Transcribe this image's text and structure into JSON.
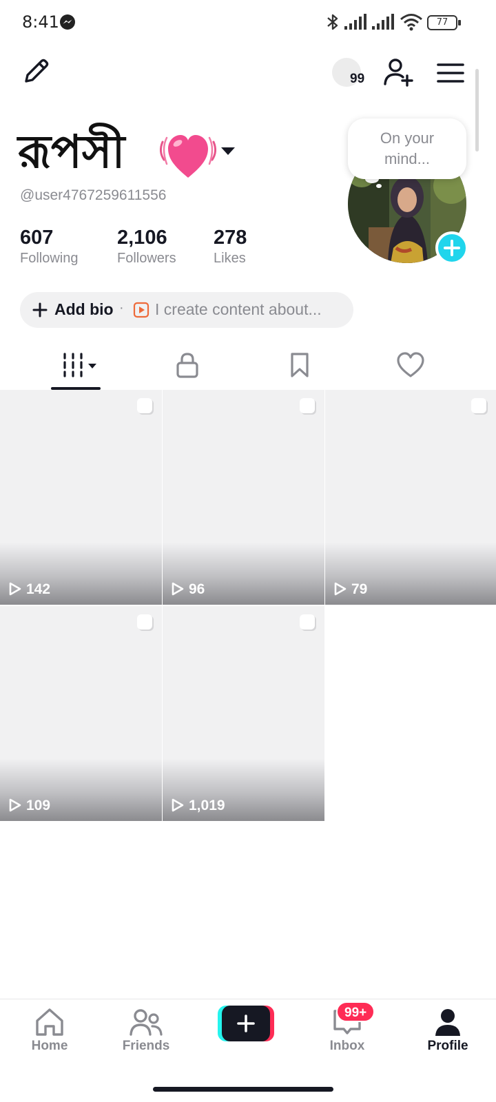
{
  "status_bar": {
    "time": "8:41",
    "battery": "77",
    "icons": [
      "messenger-icon",
      "bluetooth-icon",
      "signal-icon",
      "signal-icon",
      "wifi-icon",
      "battery-icon"
    ]
  },
  "top_nav": {
    "notification_count": "99",
    "icons": [
      "pencil-icon",
      "add-friend-icon",
      "menu-icon"
    ]
  },
  "profile": {
    "display_name": "রূপসী",
    "username": "@user4767259611556",
    "stats": [
      {
        "value": "607",
        "label": "Following"
      },
      {
        "value": "2,106",
        "label": "Followers"
      },
      {
        "value": "278",
        "label": "Likes"
      }
    ],
    "thought_bubble": "On your\nmind...",
    "bio": {
      "add_label": "Add bio",
      "separator": "·",
      "hint": "I create content about..."
    }
  },
  "tabs": [
    {
      "name": "videos",
      "icon": "grid-videos-icon",
      "active": true
    },
    {
      "name": "private",
      "icon": "lock-icon",
      "active": false
    },
    {
      "name": "saved",
      "icon": "bookmark-icon",
      "active": false
    },
    {
      "name": "liked",
      "icon": "heart-outline-icon",
      "active": false
    }
  ],
  "videos": [
    {
      "views": "142"
    },
    {
      "views": "96"
    },
    {
      "views": "79"
    },
    {
      "views": "109"
    },
    {
      "views": "1,019"
    }
  ],
  "bottom_nav": {
    "items": [
      {
        "label": "Home",
        "icon": "home-icon"
      },
      {
        "label": "Friends",
        "icon": "friends-icon"
      },
      {
        "label": "",
        "icon": "plus-icon"
      },
      {
        "label": "Inbox",
        "icon": "inbox-icon"
      },
      {
        "label": "Profile",
        "icon": "profile-icon"
      }
    ],
    "inbox_badge": "99+"
  },
  "colors": {
    "accent_cyan": "#20d5ec",
    "accent_pink": "#fe2c55",
    "text_primary": "#161823",
    "text_secondary": "#8a8b91"
  }
}
